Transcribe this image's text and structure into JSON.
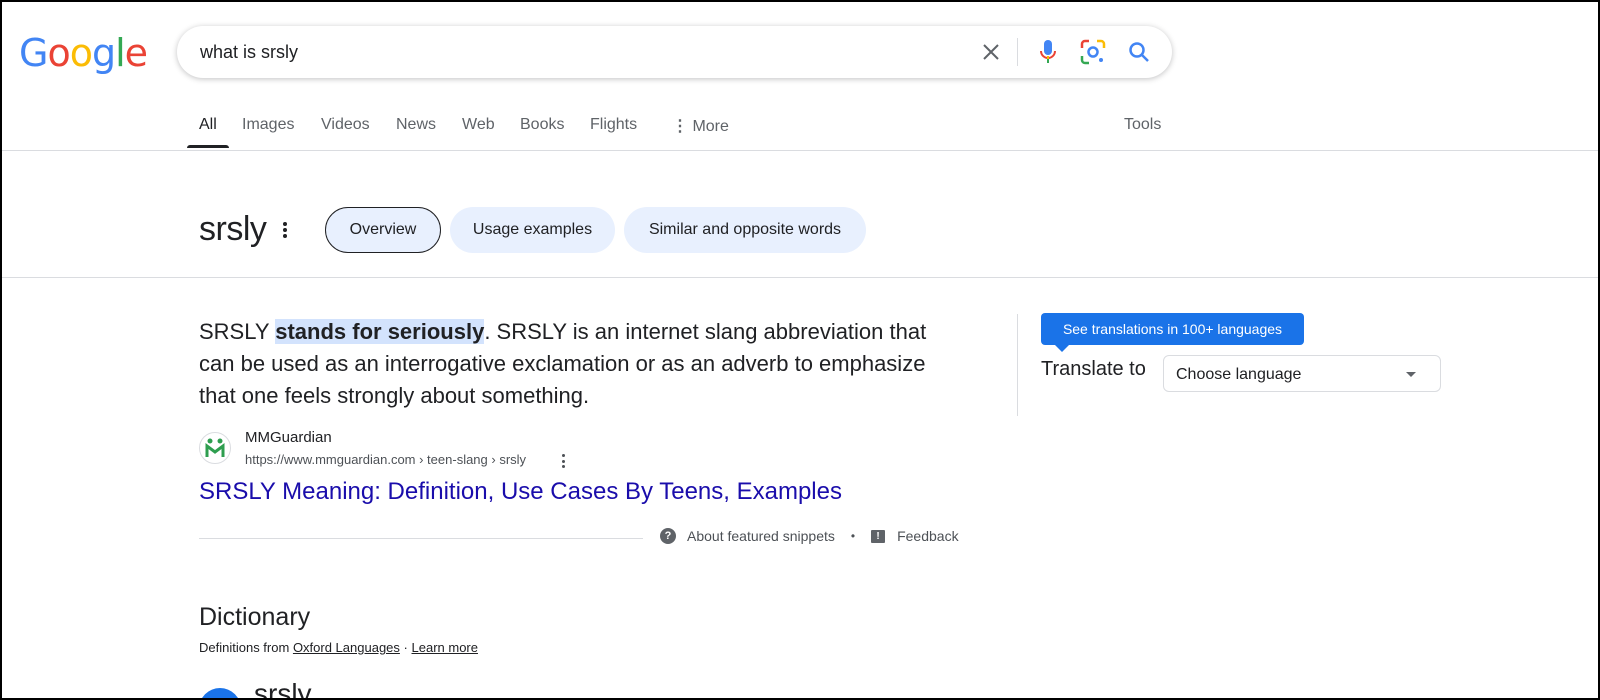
{
  "header": {
    "logo_text": "Google",
    "search_query": "what is srsly",
    "icons": [
      "clear-icon",
      "microphone-icon",
      "lens-icon",
      "search-icon"
    ]
  },
  "tabs": {
    "items": [
      "All",
      "Images",
      "Videos",
      "News",
      "Web",
      "Books",
      "Flights",
      "More"
    ],
    "active": "All",
    "tools_label": "Tools"
  },
  "word_panel": {
    "word": "srsly",
    "chips": [
      "Overview",
      "Usage examples",
      "Similar and opposite words"
    ],
    "selected_chip": "Overview"
  },
  "snippet": {
    "text_before": "SRSLY ",
    "highlight": "stands for seriously",
    "text_after": ". SRSLY is an internet slang abbreviation that can be used as an interrogative exclamation or as an adverb to emphasize that one feels strongly about something.",
    "source_name": "MMGuardian",
    "source_url": "https://www.mmguardian.com › teen-slang › srsly",
    "link_title": "SRSLY Meaning: Definition, Use Cases By Teens, Examples",
    "about_label": "About featured snippets",
    "separator": "•",
    "feedback_label": "Feedback"
  },
  "translate": {
    "button_label": "See translations in 100+ languages",
    "label": "Translate to",
    "select_value": "Choose language"
  },
  "dictionary": {
    "title": "Dictionary",
    "definitions_from": "Definitions from",
    "source": "Oxford Languages",
    "dot": "·",
    "learn_more": "Learn more",
    "word": "srsly"
  },
  "colors": {
    "link": "#1a0dab",
    "accent": "#1a73e8",
    "chip_bg": "#e8f0fe",
    "highlight_bg": "#d3e3fd"
  }
}
